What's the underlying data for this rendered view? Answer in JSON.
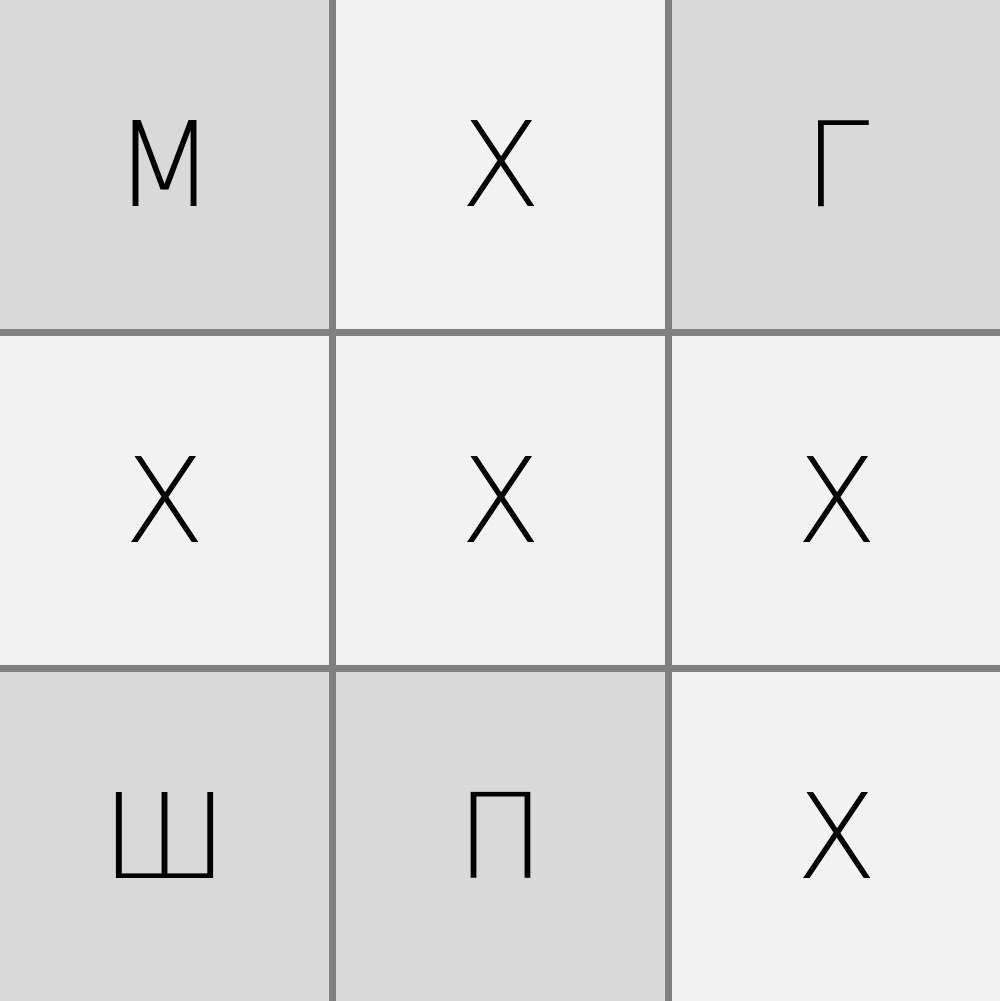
{
  "board": {
    "colors": {
      "dark": "#d9d9d9",
      "light": "#f2f2f2",
      "grid": "#808080",
      "text": "#000000"
    },
    "cells": [
      {
        "label": "М",
        "shade": "dark"
      },
      {
        "label": "Х",
        "shade": "light"
      },
      {
        "label": "Г",
        "shade": "dark"
      },
      {
        "label": "Х",
        "shade": "light"
      },
      {
        "label": "Х",
        "shade": "light"
      },
      {
        "label": "Х",
        "shade": "light"
      },
      {
        "label": "Ш",
        "shade": "dark"
      },
      {
        "label": "П",
        "shade": "dark"
      },
      {
        "label": "Х",
        "shade": "light"
      }
    ]
  }
}
